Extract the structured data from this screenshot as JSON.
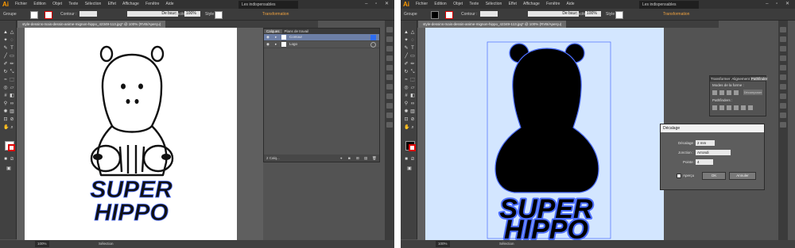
{
  "app": {
    "logo": "Ai",
    "menus": [
      "Fichier",
      "Edition",
      "Objet",
      "Texte",
      "Sélection",
      "Effet",
      "Affichage",
      "Fenêtre",
      "Aide"
    ],
    "workspace": "Les indispensables",
    "window_controls": "– ▫ ✕"
  },
  "control_bar": {
    "selection": "Groupe",
    "stroke_label": "Contour :",
    "stroke_profile": "De base",
    "opacity_label": "Opacité :",
    "opacity_value": "100%",
    "style_label": "Style :",
    "transform_link": "Transformation"
  },
  "document": {
    "tab_title": "style-dessins-mais-dessin-anime-mignon-hippo_42349-113.jpg* @ 100% (RVB/Aperçu)",
    "status_zoom": "100%",
    "status_tool": "Sélection"
  },
  "artwork": {
    "line1": "SUPER",
    "line2": "HIPPO"
  },
  "layers_panel": {
    "tabs": [
      "Calques",
      "Plans de travail"
    ],
    "layers": [
      "Contour",
      "Logo"
    ],
    "footer_count": "2 Calq..."
  },
  "pathfinder_panel": {
    "tabs": [
      "Transformer",
      "Alignement",
      "Pathfinder"
    ],
    "shape_modes_label": "Modes de la forme :",
    "expand_button": "Décomposer",
    "pathfinders_label": "Pathfinders :"
  },
  "offset_dialog": {
    "title": "Décalage",
    "offset_label": "Décalage :",
    "offset_value": "2 mm",
    "join_label": "Jonction :",
    "join_value": "Arrondi",
    "miter_label": "Pointe :",
    "miter_value": "4",
    "preview_label": "Aperçu",
    "ok_label": "OK",
    "cancel_label": "Annuler"
  },
  "colors": {
    "accent": "#f1a340",
    "path_blue": "#4a6cff",
    "artboard_blue": "#d3e6ff"
  }
}
